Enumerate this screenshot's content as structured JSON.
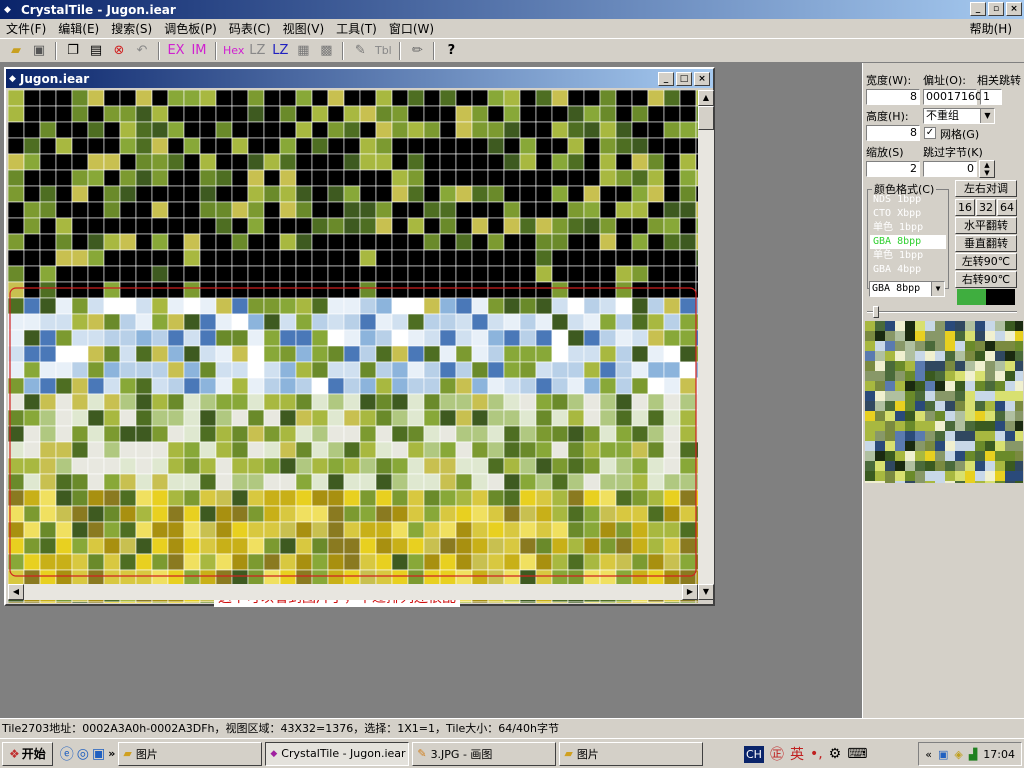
{
  "window": {
    "title": "CrystalTile - Jugon.iear",
    "buttons": [
      "_",
      "▫",
      "×"
    ]
  },
  "menu": {
    "items": [
      "文件(F)",
      "编辑(E)",
      "搜索(S)",
      "调色板(P)",
      "码表(C)",
      "视图(V)",
      "工具(T)",
      "窗口(W)"
    ],
    "help": "帮助(H)"
  },
  "toolbar": {
    "ex_label": "EX",
    "im_label": "IM",
    "hex_label": "Hex",
    "lz1_label": "LZ",
    "lz2_label": "LZ",
    "tbl_label": "Tbl"
  },
  "child": {
    "title": "Jugon.iear",
    "annotation": "这下可以看到图片了，不过排列还很乱"
  },
  "panel": {
    "width_label": "宽度(W):",
    "width_value": "8",
    "offset_label": "偏址(O):",
    "offset_value": "00017160",
    "jump_label": "相关跳转",
    "jump_value": "1",
    "height_label": "高度(H):",
    "height_value": "8",
    "group_value": "不重组",
    "grid_label": "网格(G)",
    "grid_checked": true,
    "zoom_label": "缩放(S)",
    "zoom_value": "2",
    "skip_label": "跳过字节(K)",
    "skip_value": "0",
    "format_label": "颜色格式(C)",
    "formats": [
      "NDS  1bpp",
      "CTO  Xbpp",
      "单色  1bpp",
      "GBA  8bpp",
      "单色  1bpp",
      "GBA  4bpp"
    ],
    "format_selected": 3,
    "format_combo": "GBA  8bpp",
    "btn_flip_lr_adj": "左右对调",
    "size_16": "16",
    "size_32": "32",
    "size_64": "64",
    "btn_hflip": "水平翻转",
    "btn_vflip": "垂直翻转",
    "btn_rot_left": "左转90℃",
    "btn_rot_right": "右转90℃",
    "color_fg": "#3fae3f",
    "color_bg": "#000000"
  },
  "status": {
    "text": "Tile2703地址：0002A3A0h-0002A3DFh，视图区域：43X32=1376，选择：1X1=1，Tile大小：64/40h字节"
  },
  "taskbar": {
    "start_label": "开始",
    "tasks": [
      "图片",
      "CrystalTile - Jugon.iear",
      "3.JPG - 画图",
      "图片"
    ],
    "ime_ch": "CH",
    "ime_lang": "英",
    "clock": "17:04"
  }
}
